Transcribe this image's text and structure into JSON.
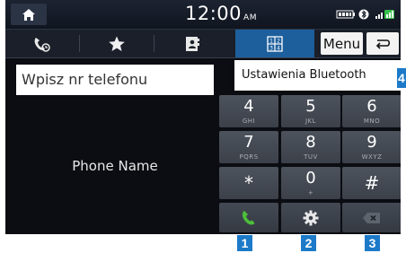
{
  "status": {
    "time": "12:00",
    "ampm": "AM"
  },
  "menu": {
    "menu_label": "Menu"
  },
  "dial": {
    "input_placeholder": "Wpisz nr telefonu",
    "phone_name": "Phone Name"
  },
  "dropdown": {
    "bluetooth_settings": "Ustawienia Bluetooth"
  },
  "keypad": {
    "keys": [
      {
        "digit": "4",
        "letters": "GHI"
      },
      {
        "digit": "5",
        "letters": "JKL"
      },
      {
        "digit": "6",
        "letters": "MNO"
      },
      {
        "digit": "7",
        "letters": "PQRS"
      },
      {
        "digit": "8",
        "letters": "TUV"
      },
      {
        "digit": "9",
        "letters": "WXYZ"
      },
      {
        "digit": "*",
        "letters": ""
      },
      {
        "digit": "0",
        "letters": "+"
      },
      {
        "digit": "#",
        "letters": ""
      }
    ]
  },
  "markers": {
    "m1": "1",
    "m2": "2",
    "m3": "3",
    "m4": "4"
  },
  "colors": {
    "accent_tab": "#1d5f9c",
    "call_green": "#4cbf3a",
    "marker_blue": "#1c7ac8"
  },
  "icons": [
    "home-icon",
    "bluetooth-icon",
    "signal-icon",
    "battery-icon",
    "recent-calls-icon",
    "favorites-icon",
    "contacts-icon",
    "keypad-icon",
    "back-icon",
    "call-icon",
    "settings-gear-icon",
    "backspace-icon"
  ]
}
